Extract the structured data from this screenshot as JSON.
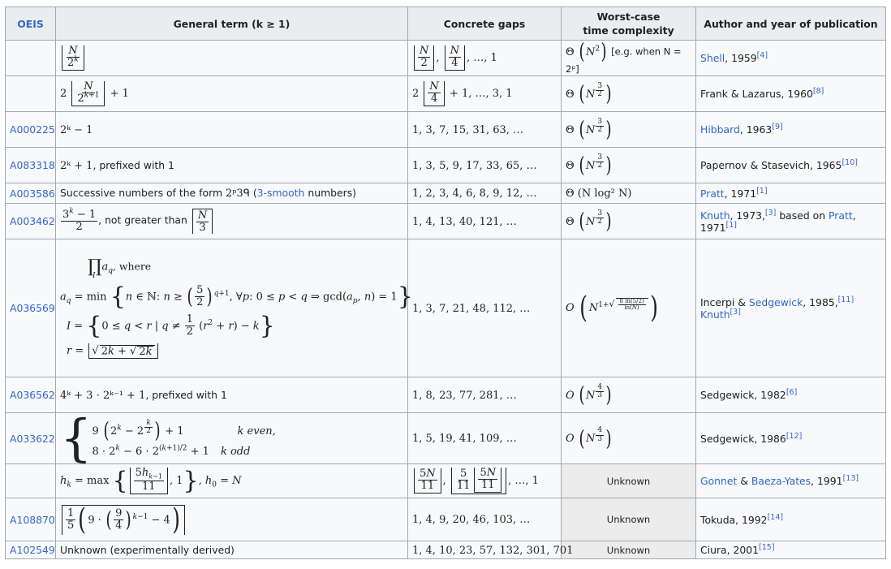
{
  "table": {
    "headers": {
      "oeis": "OEIS",
      "general_term": "General term (k ≥ 1)",
      "concrete_gaps": "Concrete gaps",
      "worst_case_line1": "Worst-case",
      "worst_case_line2": "time complexity",
      "author_year": "Author and year of publication"
    },
    "rows": [
      {
        "oeis": "",
        "gaps": "…, 1",
        "complexity_note": "[e.g. when N = 2ᵖ]",
        "author": "Shell",
        "year": ", 1959",
        "ref": "[4]"
      },
      {
        "oeis": "",
        "term_suffix": "+ 1",
        "gaps": "+ 1, …, 3, 1",
        "author": "Frank & Lazarus, 1960",
        "ref": "[8]"
      },
      {
        "oeis": "A000225",
        "term": "2ᵏ − 1",
        "gaps": "1, 3, 7, 15, 31, 63, …",
        "author": "Hibbard",
        "year": ", 1963",
        "ref": "[9]"
      },
      {
        "oeis": "A083318",
        "term": "2ᵏ + 1",
        "term_text": ", prefixed with 1",
        "gaps": "1, 3, 5, 9, 17, 33, 65, …",
        "author": "Papernov & Stasevich, 1965",
        "ref": "[10]"
      },
      {
        "oeis": "A003586",
        "term_text_a": "Successive numbers of the form ",
        "term_math": "2ᵖ3ᑫ",
        "term_paren_open": " (",
        "term_link": "3-smooth",
        "term_text_b": " numbers)",
        "gaps": "1, 2, 3, 4, 6, 8, 9, 12, …",
        "complexity": "Θ (N log² N)",
        "author": "Pratt",
        "year": ", 1971",
        "ref": "[1]"
      },
      {
        "oeis": "A003462",
        "term_text": ", not greater than",
        "gaps": "1, 4, 13, 40, 121, …",
        "author": "Knuth",
        "year": ", 1973,",
        "ref": "[3]",
        "author_b_text": " based on ",
        "author_b": "Pratt",
        "year_b": ", 1971",
        "ref_b": "[1]"
      },
      {
        "oeis": "A036569",
        "term_line1_text": ", where",
        "term_line3_text": "cd",
        "gaps": "1, 3, 7, 21, 48, 112, …",
        "author_text": "Incerpi & ",
        "author": "Sedgewick",
        "year": ", 1985,",
        "ref": "[11]",
        "author_b": "Knuth",
        "ref_b": "[3]"
      },
      {
        "oeis": "A036562",
        "term": "4ᵏ + 3 · 2ᵏ⁻¹ + 1",
        "term_text": ", prefixed with 1",
        "gaps": "1, 8, 23, 77, 281, …",
        "author": "Sedgewick, 1982",
        "ref": "[6]"
      },
      {
        "oeis": "A033622",
        "case1_cond": "k even,",
        "case2_cond": "k odd",
        "gaps": "1, 5, 19, 41, 109, …",
        "author": "Sedgewick, 1986",
        "ref": "[12]"
      },
      {
        "oeis": "",
        "gaps": "…, 1",
        "complexity": "Unknown",
        "author": "Gonnet",
        "author_mid": " & ",
        "author_b": "Baeza-Yates",
        "year": ", 1991",
        "ref": "[13]"
      },
      {
        "oeis": "A108870",
        "gaps": "1, 4, 9, 20, 46, 103, …",
        "complexity": "Unknown",
        "author": "Tokuda, 1992",
        "ref": "[14]"
      },
      {
        "oeis": "A102549",
        "term_text": "Unknown (experimentally derived)",
        "gaps": "1, 4, 10, 23, 57, 132, 301, 701",
        "complexity": "Unknown",
        "author": "Ciura, 2001",
        "ref": "[15]"
      }
    ]
  }
}
